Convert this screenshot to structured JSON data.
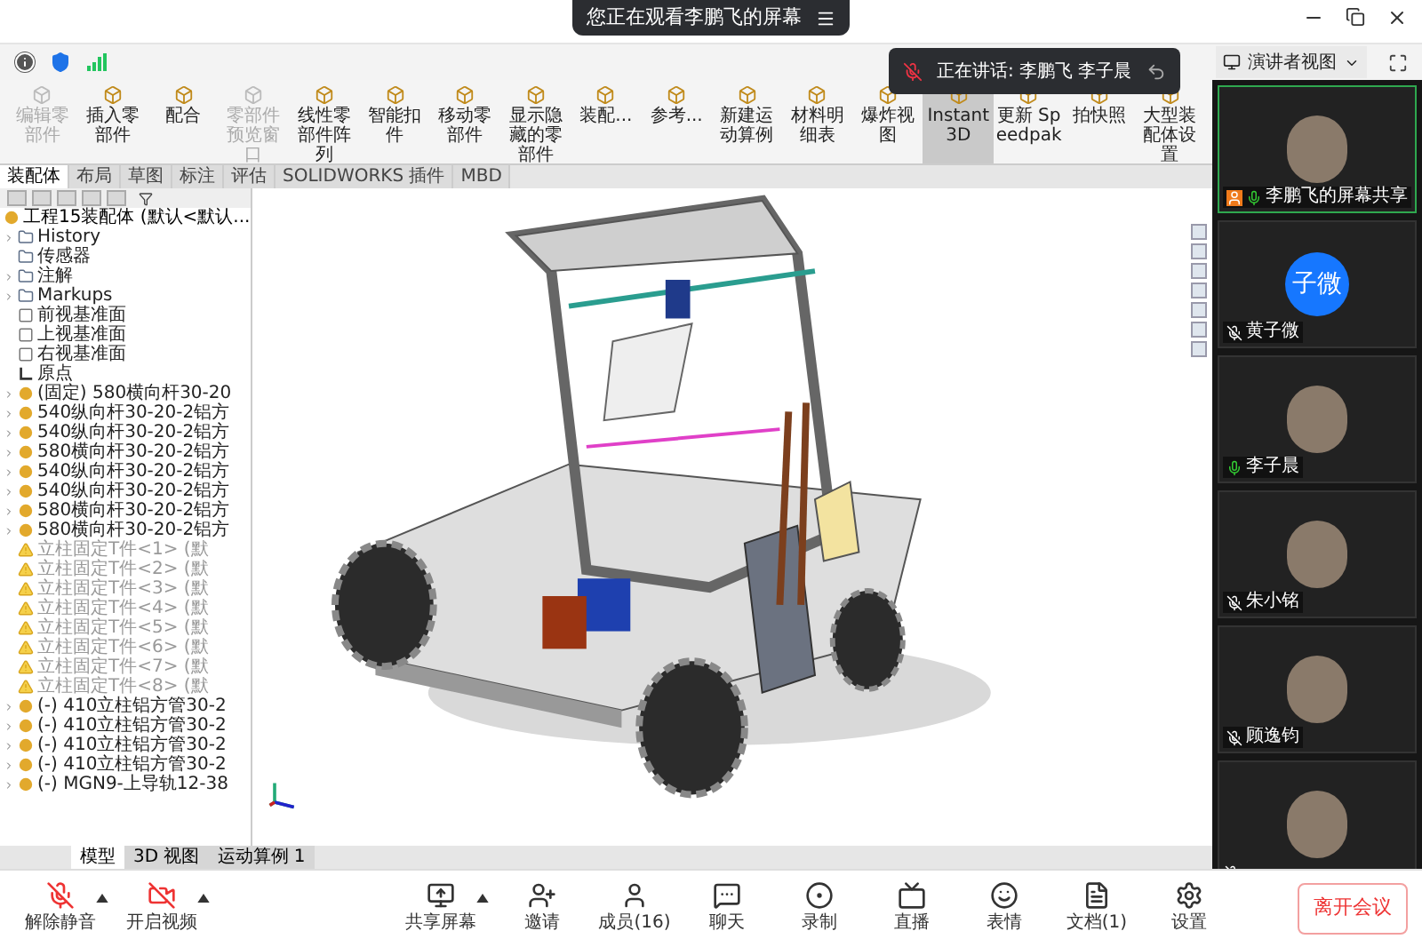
{
  "meeting_bar": {
    "title": "您正在观看李鹏飞的屏幕"
  },
  "speaking": {
    "text": "正在讲话: 李鹏飞 李子晨"
  },
  "view_button": {
    "label": "演讲者视图"
  },
  "cad": {
    "ribbon": [
      {
        "label": "编辑零部件",
        "disabled": true,
        "selected": false
      },
      {
        "label": "插入零部件",
        "disabled": false,
        "selected": false
      },
      {
        "label": "配合",
        "disabled": false,
        "selected": false
      },
      {
        "label": "零部件预览窗口",
        "disabled": true,
        "selected": false
      },
      {
        "label": "线性零部件阵列",
        "disabled": false,
        "selected": false
      },
      {
        "label": "智能扣件",
        "disabled": false,
        "selected": false
      },
      {
        "label": "移动零部件",
        "disabled": false,
        "selected": false
      },
      {
        "label": "显示隐藏的零部件",
        "disabled": false,
        "selected": false
      },
      {
        "label": "装配...",
        "disabled": false,
        "selected": false
      },
      {
        "label": "参考...",
        "disabled": false,
        "selected": false
      },
      {
        "label": "新建运动算例",
        "disabled": false,
        "selected": false
      },
      {
        "label": "材料明细表",
        "disabled": false,
        "selected": false
      },
      {
        "label": "爆炸视图",
        "disabled": false,
        "selected": false
      },
      {
        "label": "Instant3D",
        "disabled": false,
        "selected": true
      },
      {
        "label": "更新 Speedpak",
        "disabled": false,
        "selected": false
      },
      {
        "label": "拍快照",
        "disabled": false,
        "selected": false
      },
      {
        "label": "大型装配体设置",
        "disabled": false,
        "selected": false
      }
    ],
    "tabs": [
      {
        "label": "装配体",
        "selected": true
      },
      {
        "label": "布局",
        "selected": false
      },
      {
        "label": "草图",
        "selected": false
      },
      {
        "label": "标注",
        "selected": false
      },
      {
        "label": "评估",
        "selected": false
      },
      {
        "label": "SOLIDWORKS 插件",
        "selected": false
      },
      {
        "label": "MBD",
        "selected": false
      }
    ],
    "tree": {
      "root": "工程15装配体 (默认<默认...",
      "items": [
        {
          "label": "History",
          "kind": "folder",
          "collapsible": true
        },
        {
          "label": "传感器",
          "kind": "folder",
          "collapsible": false
        },
        {
          "label": "注解",
          "kind": "folder",
          "collapsible": true
        },
        {
          "label": "Markups",
          "kind": "folder",
          "collapsible": true
        },
        {
          "label": "前视基准面",
          "kind": "plane",
          "collapsible": false
        },
        {
          "label": "上视基准面",
          "kind": "plane",
          "collapsible": false
        },
        {
          "label": "右视基准面",
          "kind": "plane",
          "collapsible": false
        },
        {
          "label": "原点",
          "kind": "origin",
          "collapsible": false
        },
        {
          "label": "(固定) 580横向杆30-20",
          "kind": "part",
          "collapsible": true
        },
        {
          "label": "540纵向杆30-20-2铝方",
          "kind": "part",
          "collapsible": true
        },
        {
          "label": "540纵向杆30-20-2铝方",
          "kind": "part",
          "collapsible": true
        },
        {
          "label": "580横向杆30-20-2铝方",
          "kind": "part",
          "collapsible": true
        },
        {
          "label": "540纵向杆30-20-2铝方",
          "kind": "part",
          "collapsible": true
        },
        {
          "label": "540纵向杆30-20-2铝方",
          "kind": "part",
          "collapsible": true
        },
        {
          "label": "580横向杆30-20-2铝方",
          "kind": "part",
          "collapsible": true
        },
        {
          "label": "580横向杆30-20-2铝方",
          "kind": "part",
          "collapsible": true
        },
        {
          "label": "立柱固定T件<1> (默",
          "kind": "warning",
          "collapsible": false
        },
        {
          "label": "立柱固定T件<2> (默",
          "kind": "warning",
          "collapsible": false
        },
        {
          "label": "立柱固定T件<3> (默",
          "kind": "warning",
          "collapsible": false
        },
        {
          "label": "立柱固定T件<4> (默",
          "kind": "warning",
          "collapsible": false
        },
        {
          "label": "立柱固定T件<5> (默",
          "kind": "warning",
          "collapsible": false
        },
        {
          "label": "立柱固定T件<6> (默",
          "kind": "warning",
          "collapsible": false
        },
        {
          "label": "立柱固定T件<7> (默",
          "kind": "warning",
          "collapsible": false
        },
        {
          "label": "立柱固定T件<8> (默",
          "kind": "warning",
          "collapsible": false
        },
        {
          "label": "(-) 410立柱铝方管30-2",
          "kind": "part",
          "collapsible": true
        },
        {
          "label": "(-) 410立柱铝方管30-2",
          "kind": "part",
          "collapsible": true
        },
        {
          "label": "(-) 410立柱铝方管30-2",
          "kind": "part",
          "collapsible": true
        },
        {
          "label": "(-) 410立柱铝方管30-2",
          "kind": "part",
          "collapsible": true
        },
        {
          "label": "(-) MGN9-上导轨12-38",
          "kind": "part",
          "collapsible": true
        }
      ]
    },
    "bottom_tabs": [
      {
        "label": "模型",
        "selected": true
      },
      {
        "label": "3D 视图",
        "selected": false
      },
      {
        "label": "运动算例 1",
        "selected": false
      }
    ]
  },
  "participants": [
    {
      "name": "李鹏飞的屏幕共享",
      "kind": "photo",
      "muted": false,
      "selected": true
    },
    {
      "name": "黄子微",
      "kind": "initials",
      "initials": "子微",
      "muted": true,
      "selected": false
    },
    {
      "name": "李子晨",
      "kind": "photo",
      "muted": false,
      "selected": false
    },
    {
      "name": "朱小铭",
      "kind": "photo",
      "muted": true,
      "selected": false
    },
    {
      "name": "顾逸钧",
      "kind": "photo",
      "muted": true,
      "selected": false
    },
    {
      "kind": "photo",
      "muted": true,
      "selected": false
    }
  ],
  "toolbar": [
    {
      "label": "解除静音",
      "kind": "mic-off",
      "caret": true
    },
    {
      "label": "开启视频",
      "kind": "video-off",
      "caret": true
    },
    {
      "label": "共享屏幕",
      "kind": "share",
      "caret": true
    },
    {
      "label": "邀请",
      "kind": "invite",
      "caret": false
    },
    {
      "label": "成员(16)",
      "kind": "members",
      "caret": false
    },
    {
      "label": "聊天",
      "kind": "chat",
      "caret": false
    },
    {
      "label": "录制",
      "kind": "record",
      "caret": false
    },
    {
      "label": "直播",
      "kind": "live",
      "caret": false
    },
    {
      "label": "表情",
      "kind": "emoji",
      "caret": false
    },
    {
      "label": "文档(1)",
      "kind": "docs",
      "caret": false
    },
    {
      "label": "设置",
      "kind": "settings",
      "caret": false
    }
  ],
  "leave_button": {
    "label": "离开会议"
  }
}
